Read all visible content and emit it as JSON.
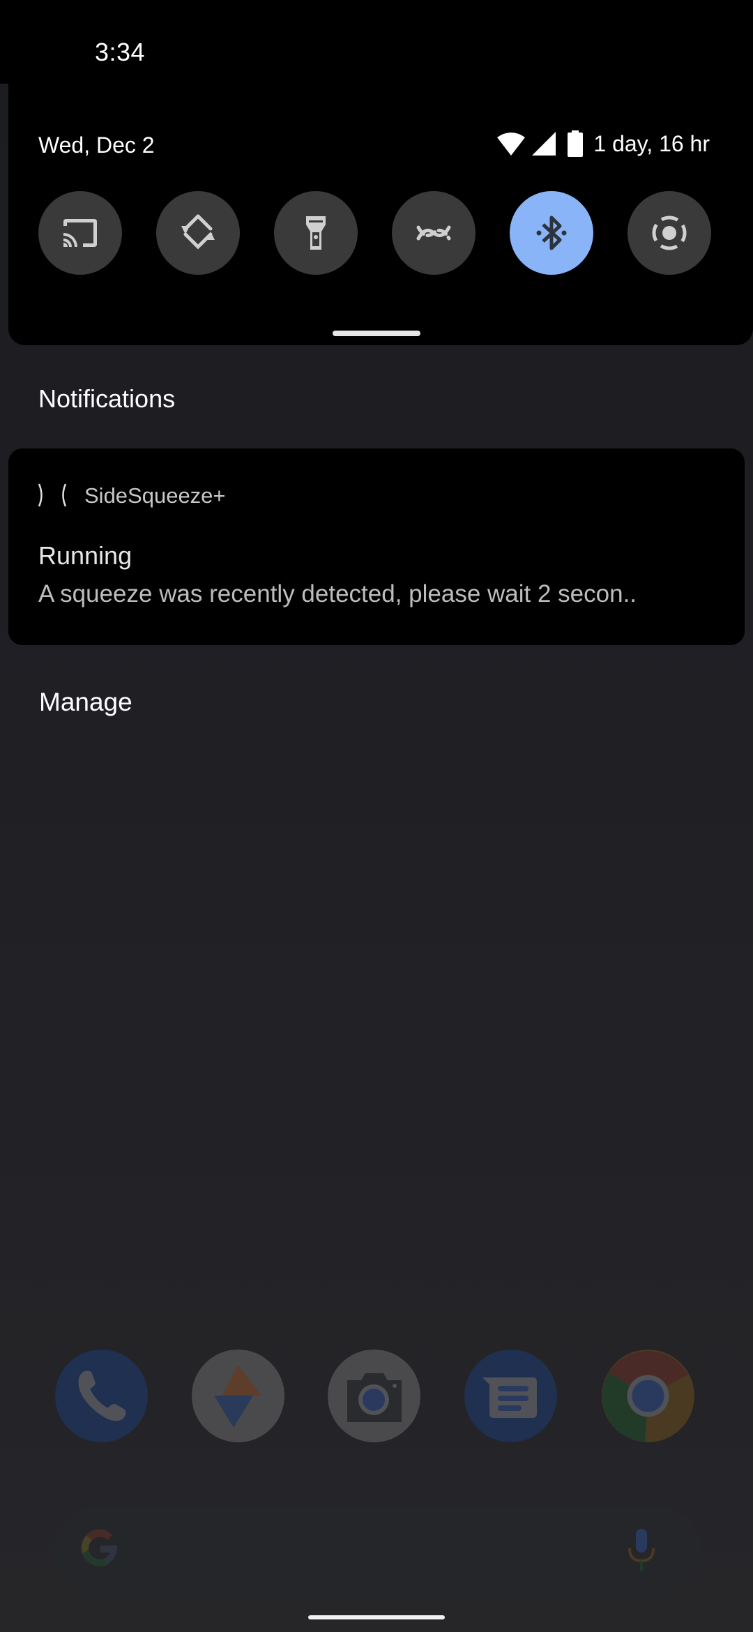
{
  "status_bar": {
    "time": "3:34"
  },
  "quick_settings": {
    "date": "Wed, Dec 2",
    "battery_text": "1 day, 16 hr",
    "tiles": [
      {
        "name": "Cast",
        "icon": "cast-icon",
        "active": false
      },
      {
        "name": "Auto-rotate",
        "icon": "rotate-icon",
        "active": false
      },
      {
        "name": "Flashlight",
        "icon": "flashlight-icon",
        "active": false
      },
      {
        "name": "Nearby Share",
        "icon": "nearby-share-icon",
        "active": false
      },
      {
        "name": "Bluetooth",
        "icon": "bluetooth-icon",
        "active": true
      },
      {
        "name": "Screen record",
        "icon": "screen-record-icon",
        "active": false
      }
    ],
    "active_color": "#8ab4f8",
    "inactive_color": "#3a3a3a"
  },
  "notifications": {
    "header": "Notifications",
    "items": [
      {
        "app_icon": "squeeze-icon",
        "app_name": "SideSqueeze+",
        "title": "Running",
        "text": "A squeeze was recently detected, please wait 2 secon.."
      }
    ],
    "manage_label": "Manage"
  },
  "home": {
    "dock": [
      {
        "name": "Phone",
        "icon": "phone-icon"
      },
      {
        "name": "Photos/App",
        "icon": "app-triangle-icon"
      },
      {
        "name": "Camera",
        "icon": "camera-icon"
      },
      {
        "name": "Messages",
        "icon": "messages-icon"
      },
      {
        "name": "Chrome",
        "icon": "chrome-icon"
      }
    ],
    "search_bar": {
      "logo": "google-g-icon",
      "mic": "mic-icon"
    }
  }
}
